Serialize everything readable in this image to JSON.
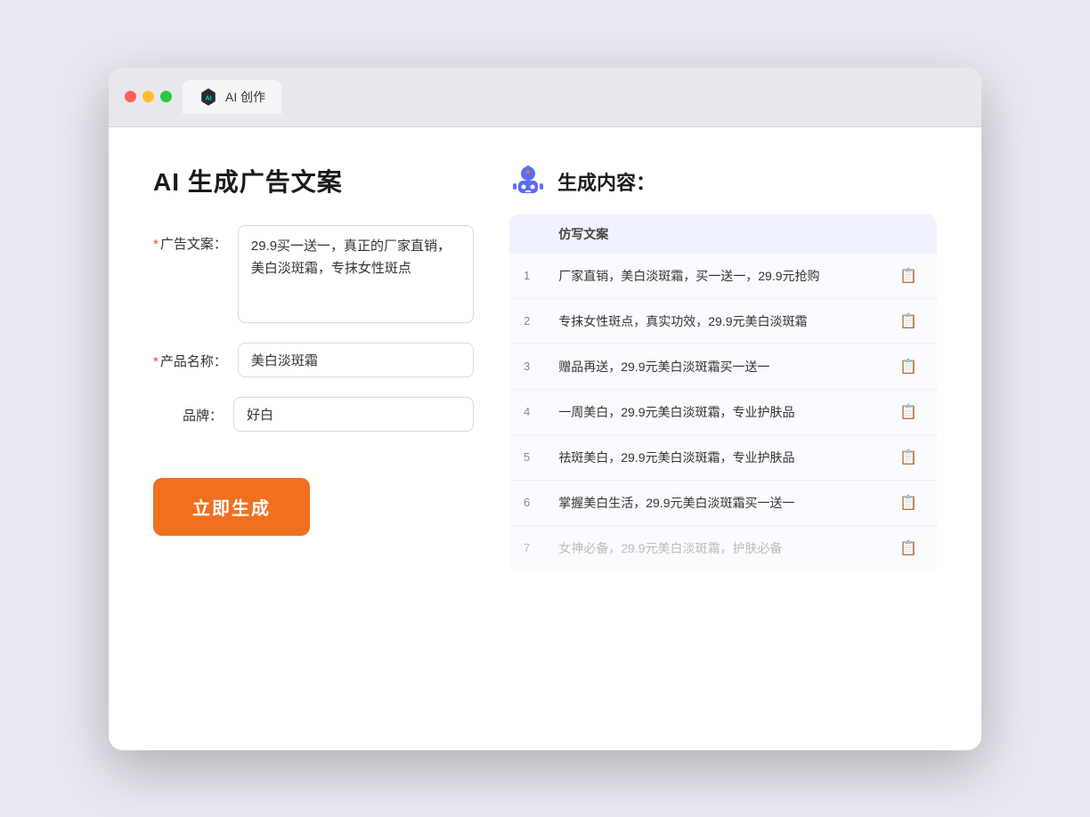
{
  "browser": {
    "tab_label": "AI 创作"
  },
  "left": {
    "title": "AI 生成广告文案",
    "fields": [
      {
        "id": "ad_text",
        "label": "广告文案：",
        "required": true,
        "type": "textarea",
        "value": "29.9买一送一，真正的厂家直销，美白淡斑霜，专抹女性斑点"
      },
      {
        "id": "product_name",
        "label": "产品名称：",
        "required": true,
        "type": "input",
        "value": "美白淡斑霜"
      },
      {
        "id": "brand",
        "label": "品牌：",
        "required": false,
        "type": "input",
        "value": "好白"
      }
    ],
    "generate_btn": "立即生成"
  },
  "right": {
    "title": "生成内容：",
    "table_header": "仿写文案",
    "results": [
      {
        "num": "1",
        "text": "厂家直销，美白淡斑霜，买一送一，29.9元抢购",
        "faded": false
      },
      {
        "num": "2",
        "text": "专抹女性斑点，真实功效，29.9元美白淡斑霜",
        "faded": false
      },
      {
        "num": "3",
        "text": "赠品再送，29.9元美白淡斑霜买一送一",
        "faded": false
      },
      {
        "num": "4",
        "text": "一周美白，29.9元美白淡斑霜，专业护肤品",
        "faded": false
      },
      {
        "num": "5",
        "text": "祛斑美白，29.9元美白淡斑霜，专业护肤品",
        "faded": false
      },
      {
        "num": "6",
        "text": "掌握美白生活，29.9元美白淡斑霜买一送一",
        "faded": false
      },
      {
        "num": "7",
        "text": "女神必备，29.9元美白淡斑霜，护肤必备",
        "faded": true
      }
    ]
  }
}
